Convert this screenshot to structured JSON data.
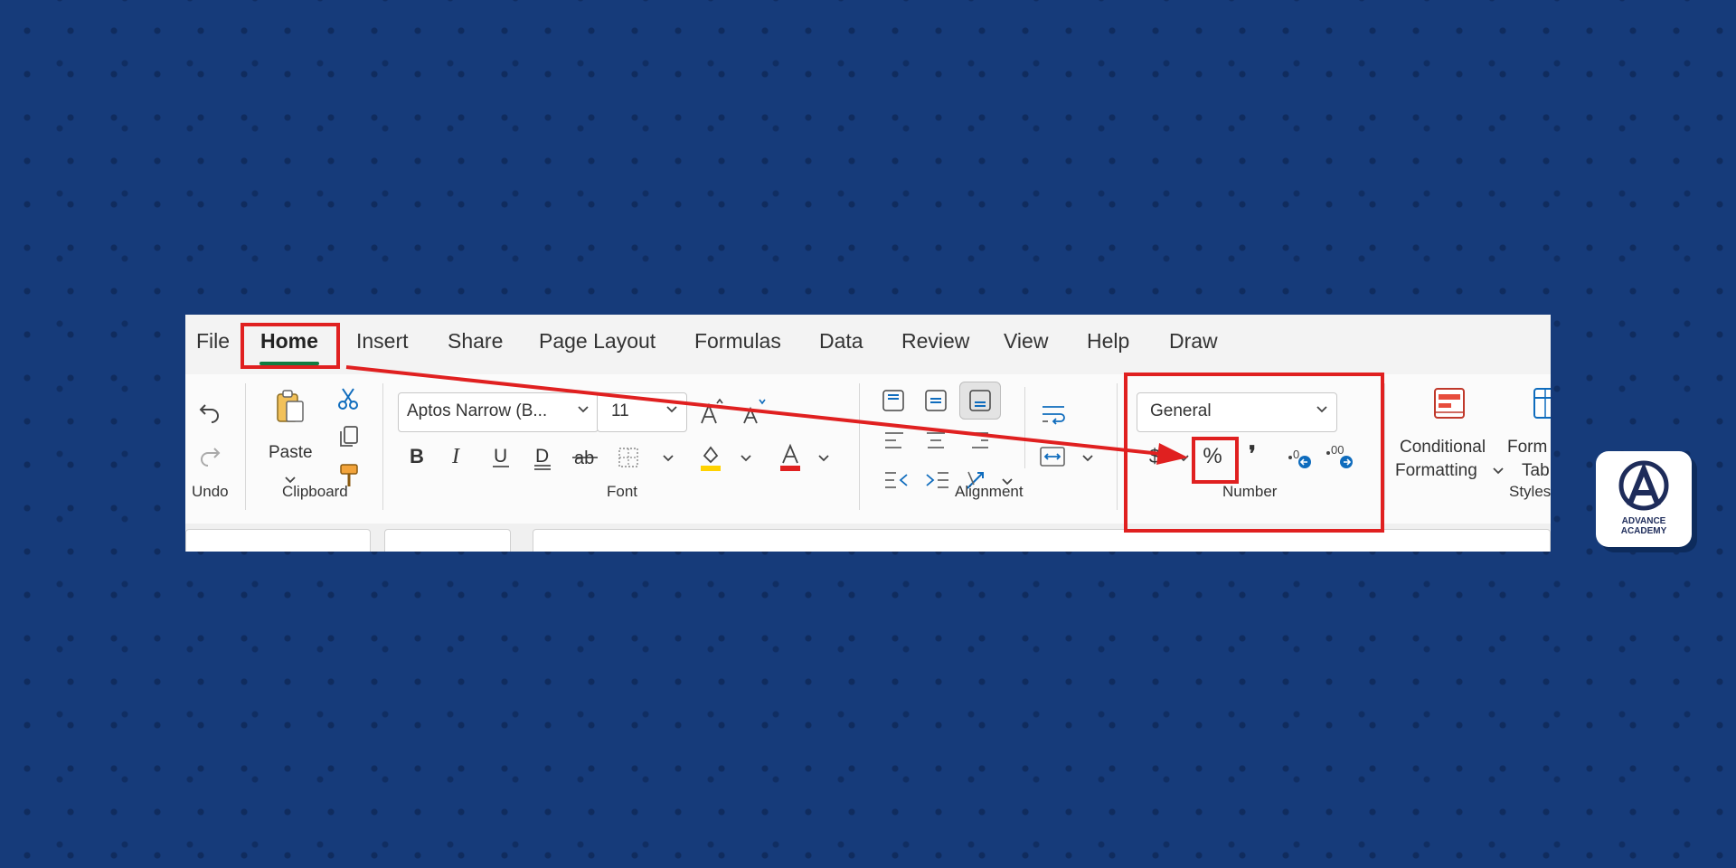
{
  "tabs": [
    "File",
    "Home",
    "Insert",
    "Share",
    "Page Layout",
    "Formulas",
    "Data",
    "Review",
    "View",
    "Help",
    "Draw"
  ],
  "active_tab": "Home",
  "groups": {
    "undo": "Undo",
    "clipboard": "Clipboard",
    "font": "Font",
    "alignment": "Alignment",
    "number": "Number",
    "styles": "Styles"
  },
  "clipboard": {
    "paste_label": "Paste"
  },
  "font": {
    "family": "Aptos Narrow (B...",
    "size": "11"
  },
  "number": {
    "format": "General",
    "percent_label": "%",
    "comma_label": "❜",
    "currency_label": "$"
  },
  "styles": {
    "conditional_line1": "Conditional",
    "conditional_line2": "Formatting",
    "format_table_line1": "Form",
    "format_table_line2": "Tab"
  },
  "logo": {
    "line1": "ADVANCE",
    "line2": "ACADEMY"
  },
  "colors": {
    "background": "#163b7a",
    "highlight": "#e02020",
    "accent_green": "#107c41",
    "fill_yellow": "#ffd200",
    "font_red": "#e02020",
    "icon_blue": "#0f6cbd"
  }
}
